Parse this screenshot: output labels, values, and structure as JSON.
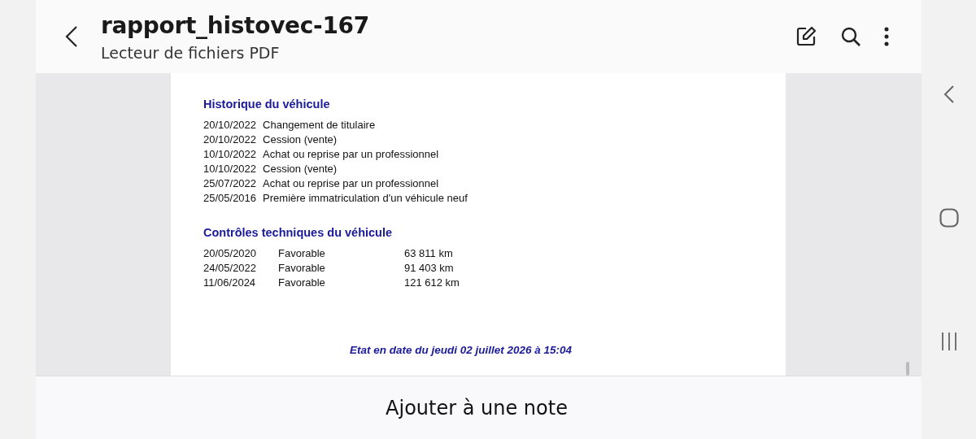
{
  "header": {
    "title": "rapport_histovec-167",
    "subtitle": "Lecteur de fichiers PDF"
  },
  "document": {
    "history": {
      "heading": "Historique du véhicule",
      "rows": [
        {
          "date": "20/10/2022",
          "event": "Changement de titulaire"
        },
        {
          "date": "20/10/2022",
          "event": "Cession (vente)"
        },
        {
          "date": "10/10/2022",
          "event": "Achat ou reprise par un professionnel"
        },
        {
          "date": "10/10/2022",
          "event": "Cession (vente)"
        },
        {
          "date": "25/07/2022",
          "event": "Achat ou reprise par un professionnel"
        },
        {
          "date": "25/05/2016",
          "event": "Première immatriculation d'un véhicule neuf"
        }
      ]
    },
    "inspections": {
      "heading": "Contrôles techniques du véhicule",
      "rows": [
        {
          "date": "20/05/2020",
          "result": "Favorable",
          "mileage": "63 811 km"
        },
        {
          "date": "24/05/2022",
          "result": "Favorable",
          "mileage": "91 403 km"
        },
        {
          "date": "11/06/2024",
          "result": "Favorable",
          "mileage": "121 612 km"
        }
      ]
    },
    "footer": "Etat en date du jeudi 02 juillet 2026 à 15:04"
  },
  "bottom_action": "Ajouter à une note"
}
